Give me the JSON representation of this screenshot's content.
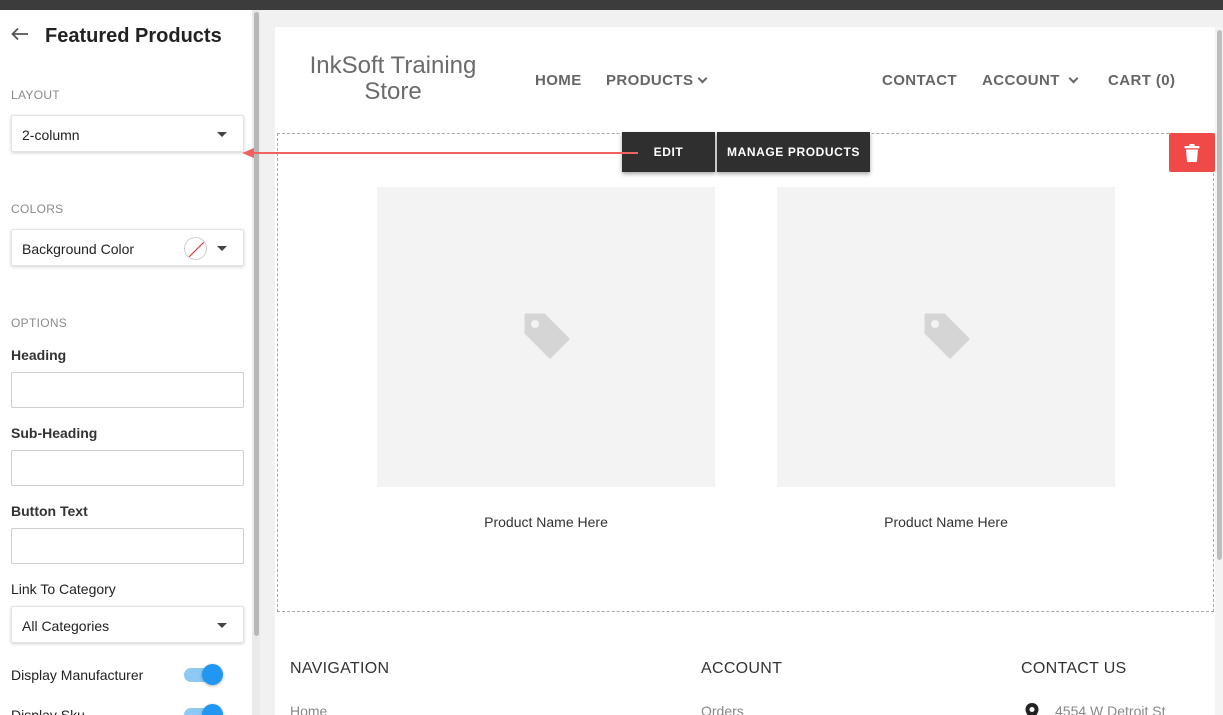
{
  "sidebar": {
    "title": "Featured Products",
    "layout_label": "LAYOUT",
    "layout_value": "2-column",
    "colors_label": "COLORS",
    "background_color_label": "Background Color",
    "options_label": "OPTIONS",
    "heading_label": "Heading",
    "heading_value": "",
    "subheading_label": "Sub-Heading",
    "subheading_value": "",
    "button_text_label": "Button Text",
    "button_text_value": "",
    "link_category_label": "Link To Category",
    "link_category_value": "All Categories",
    "toggles": [
      {
        "label": "Display Manufacturer",
        "on": true
      },
      {
        "label": "Display Sku",
        "on": true
      }
    ]
  },
  "store": {
    "logo": "InkSoft Training Store",
    "nav": {
      "home": "HOME",
      "products": "PRODUCTS",
      "contact": "CONTACT",
      "account": "ACCOUNT",
      "cart": "CART (0)"
    }
  },
  "featured": {
    "edit_label": "EDIT",
    "manage_label": "MANAGE PRODUCTS",
    "products": [
      {
        "name": "Product Name Here"
      },
      {
        "name": "Product Name Here"
      }
    ]
  },
  "footer": {
    "navigation": {
      "heading": "NAVIGATION",
      "first_link": "Home"
    },
    "account": {
      "heading": "ACCOUNT",
      "first_link": "Orders"
    },
    "contact": {
      "heading": "CONTACT US",
      "address": "4554 W Detroit St"
    }
  },
  "colors": {
    "accent_blue": "#2196f3",
    "delete_red": "#ef4a47",
    "arrow_red": "#ef6461",
    "dark_button": "#2f2f2f"
  },
  "icons": [
    "back-arrow-icon",
    "chevron-down-icon",
    "no-color-swatch-icon",
    "trash-icon",
    "price-tag-icon",
    "location-pin-icon"
  ]
}
